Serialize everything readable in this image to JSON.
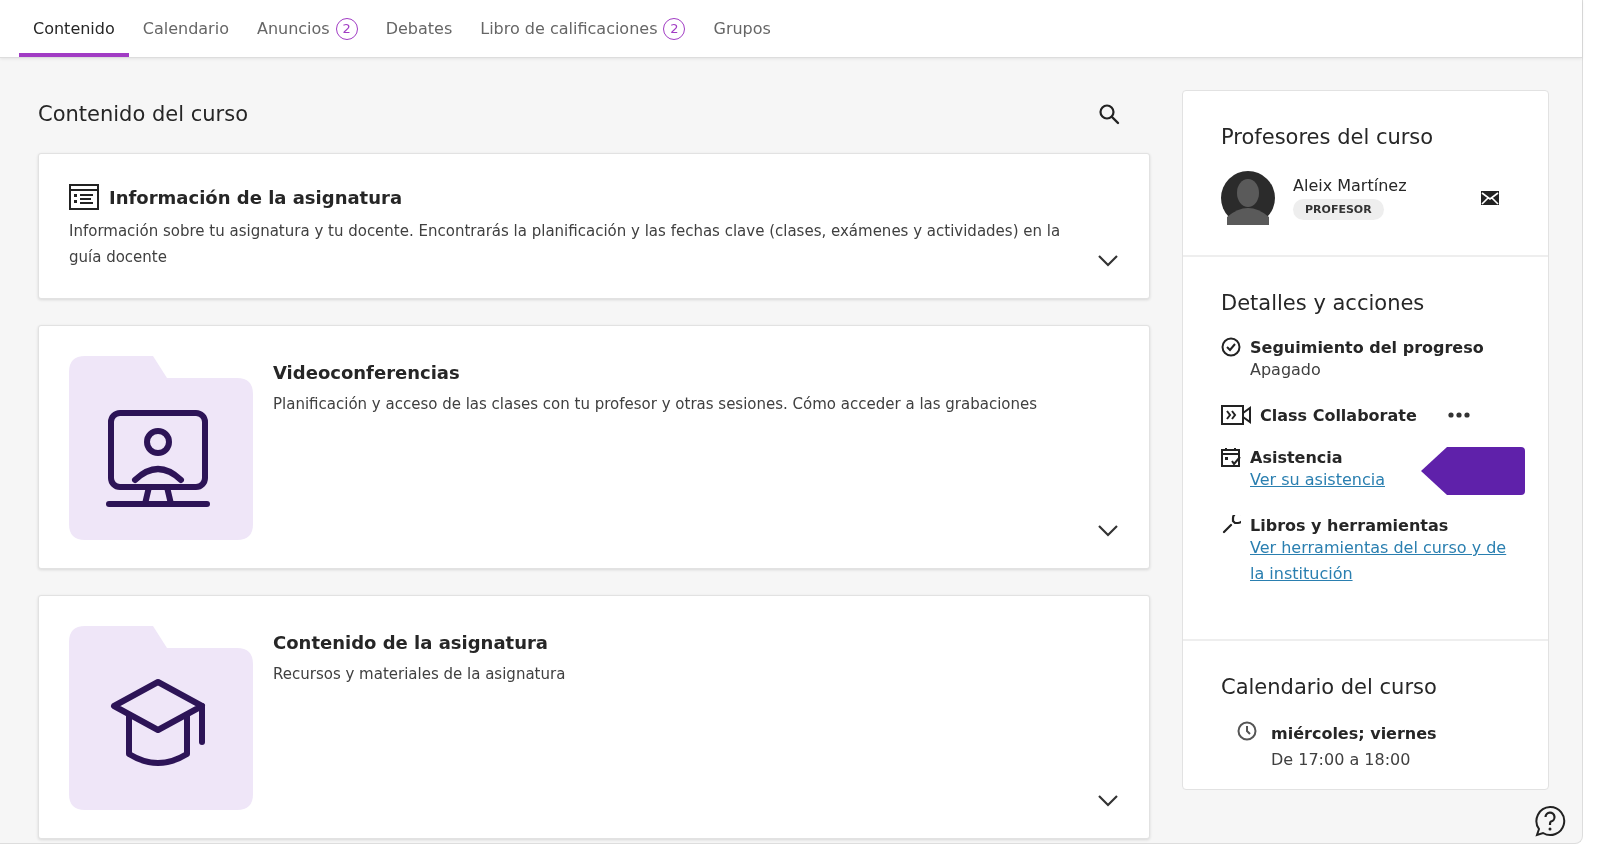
{
  "tabs": [
    {
      "label": "Contenido",
      "selected": true
    },
    {
      "label": "Calendario",
      "selected": false
    },
    {
      "label": "Anuncios",
      "selected": false,
      "badge": "2"
    },
    {
      "label": "Debates",
      "selected": false
    },
    {
      "label": "Libro de calificaciones",
      "selected": false,
      "badge": "2"
    },
    {
      "label": "Grupos",
      "selected": false
    }
  ],
  "content": {
    "title": "Contenido del curso",
    "items": [
      {
        "kind": "info",
        "title": "Información de la asignatura",
        "description": "Información sobre tu asignatura y tu docente. Encontrarás la planificación y las fechas clave (clases, exámenes y actividades) en la guía docente"
      },
      {
        "kind": "video",
        "title": "Videoconferencias",
        "description": "Planificación y acceso de las clases con tu profesor y otras sesiones. Cómo acceder a las grabaciones"
      },
      {
        "kind": "course",
        "title": "Contenido de la asignatura",
        "description": "Recursos y materiales de la asignatura"
      }
    ]
  },
  "teachers": {
    "title": "Profesores del curso",
    "people": [
      {
        "name": "Aleix Martínez",
        "role": "PROFESOR"
      }
    ]
  },
  "details": {
    "title": "Detalles y acciones",
    "items": [
      {
        "kind": "progress",
        "label": "Seguimiento del progreso",
        "value": "Apagado"
      },
      {
        "kind": "collaborate",
        "label": "Class Collaborate"
      },
      {
        "kind": "attendance",
        "label": "Asistencia",
        "link": "Ver su asistencia",
        "tag": true
      },
      {
        "kind": "tools",
        "label": "Libros y herramientas",
        "link": "Ver herramientas del curso y de la institución"
      }
    ]
  },
  "calendar": {
    "title": "Calendario del curso",
    "days": "miércoles; viernes",
    "hours": "De 17:00 a 18:00"
  }
}
